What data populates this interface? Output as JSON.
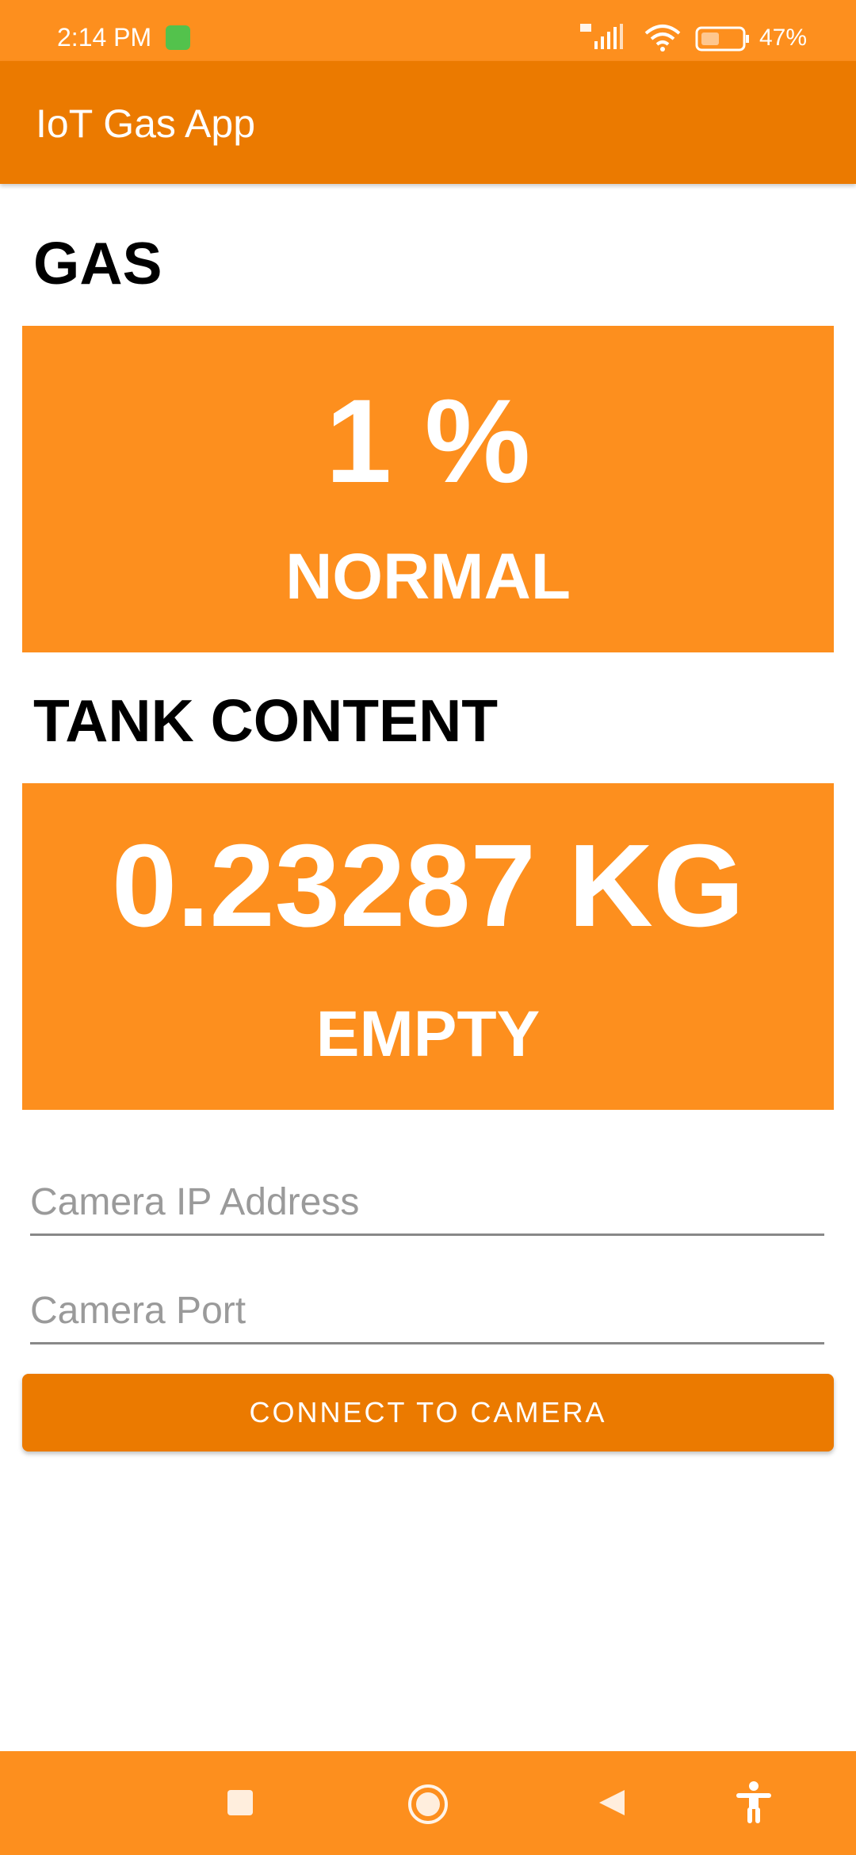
{
  "status_bar": {
    "time": "2:14 PM",
    "battery": "47%",
    "icons": [
      "app-notification-icon",
      "signal-4g-icon",
      "wifi-icon",
      "battery-icon"
    ]
  },
  "app_bar": {
    "title": "IoT Gas App"
  },
  "gas": {
    "heading": "GAS",
    "value": "1 %",
    "status": "NORMAL"
  },
  "tank": {
    "heading": "TANK CONTENT",
    "value": "0.23287 KG",
    "status": "EMPTY"
  },
  "camera": {
    "ip_placeholder": "Camera IP Address",
    "ip_value": "",
    "port_placeholder": "Camera Port",
    "port_value": "",
    "connect_label": "CONNECT TO CAMERA"
  },
  "navigation_bar": {
    "icons": [
      "recents-square-icon",
      "home-circle-icon",
      "back-triangle-icon",
      "accessibility-icon"
    ]
  },
  "colors": {
    "accent": "#FD8F1E",
    "accent_dark": "#EB7A00",
    "text": "#000000",
    "on_accent": "#FFFFFF"
  }
}
